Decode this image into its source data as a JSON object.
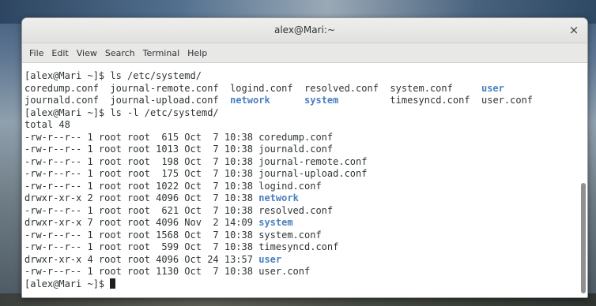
{
  "window": {
    "title": "alex@Mari:~",
    "close_glyph": "×"
  },
  "menu": [
    "File",
    "Edit",
    "View",
    "Search",
    "Terminal",
    "Help"
  ],
  "colors": {
    "directory": "#4a7fbf",
    "text": "#2e3436",
    "background": "#ffffff"
  },
  "terminal": {
    "lines": [
      [
        {
          "t": "[alex@Mari ~]$ ls /etc/systemd/",
          "d": false
        }
      ],
      [
        {
          "t": "coredump.conf  journal-remote.conf  logind.conf  resolved.conf  system.conf     ",
          "d": false
        },
        {
          "t": "user",
          "d": true
        }
      ],
      [
        {
          "t": "journald.conf  journal-upload.conf  ",
          "d": false
        },
        {
          "t": "network",
          "d": true
        },
        {
          "t": "      ",
          "d": false
        },
        {
          "t": "system",
          "d": true
        },
        {
          "t": "         timesyncd.conf  user.conf",
          "d": false
        }
      ],
      [
        {
          "t": "[alex@Mari ~]$ ls -l /etc/systemd/",
          "d": false
        }
      ],
      [
        {
          "t": "total 48",
          "d": false
        }
      ],
      [
        {
          "t": "-rw-r--r-- 1 root root  615 Oct  7 10:38 coredump.conf",
          "d": false
        }
      ],
      [
        {
          "t": "-rw-r--r-- 1 root root 1013 Oct  7 10:38 journald.conf",
          "d": false
        }
      ],
      [
        {
          "t": "-rw-r--r-- 1 root root  198 Oct  7 10:38 journal-remote.conf",
          "d": false
        }
      ],
      [
        {
          "t": "-rw-r--r-- 1 root root  175 Oct  7 10:38 journal-upload.conf",
          "d": false
        }
      ],
      [
        {
          "t": "-rw-r--r-- 1 root root 1022 Oct  7 10:38 logind.conf",
          "d": false
        }
      ],
      [
        {
          "t": "drwxr-xr-x 2 root root 4096 Oct  7 10:38 ",
          "d": false
        },
        {
          "t": "network",
          "d": true
        }
      ],
      [
        {
          "t": "-rw-r--r-- 1 root root  621 Oct  7 10:38 resolved.conf",
          "d": false
        }
      ],
      [
        {
          "t": "drwxr-xr-x 7 root root 4096 Nov  2 14:09 ",
          "d": false
        },
        {
          "t": "system",
          "d": true
        }
      ],
      [
        {
          "t": "-rw-r--r-- 1 root root 1568 Oct  7 10:38 system.conf",
          "d": false
        }
      ],
      [
        {
          "t": "-rw-r--r-- 1 root root  599 Oct  7 10:38 timesyncd.conf",
          "d": false
        }
      ],
      [
        {
          "t": "drwxr-xr-x 4 root root 4096 Oct 24 13:57 ",
          "d": false
        },
        {
          "t": "user",
          "d": true
        }
      ],
      [
        {
          "t": "-rw-r--r-- 1 root root 1130 Oct  7 10:38 user.conf",
          "d": false
        }
      ]
    ],
    "prompt": "[alex@Mari ~]$ "
  }
}
